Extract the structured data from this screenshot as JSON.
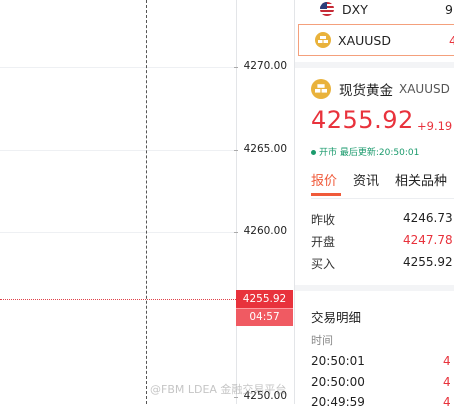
{
  "watchlist": [
    {
      "symbol": "DXY",
      "value": "9",
      "flag": "us-flag-icon"
    },
    {
      "symbol": "XAUUSD",
      "value": "4",
      "flag": "gold-coin-icon"
    }
  ],
  "price_axis": {
    "ticks": [
      "4270.00",
      "4265.00",
      "4260.00",
      "4250.00"
    ],
    "current_price": "4255.92",
    "countdown": "04:57"
  },
  "detail": {
    "name_cn": "现货黄金",
    "code": "XAUUSD",
    "price": "4255.92",
    "change": "+9.19",
    "status": "开市 最后更新:20:50:01"
  },
  "tabs": [
    {
      "label": "报价",
      "active": true
    },
    {
      "label": "资讯",
      "active": false
    },
    {
      "label": "相关品种",
      "active": false
    }
  ],
  "quote": {
    "prev_close_label": "昨收",
    "prev_close": "4246.73",
    "open_label": "开盘",
    "open": "4247.78",
    "bid_label": "买入",
    "bid": "4255.92"
  },
  "trades": {
    "title": "交易明细",
    "time_header": "时间",
    "rows": [
      {
        "time": "20:50:01",
        "price": "4"
      },
      {
        "time": "20:50:00",
        "price": "4"
      },
      {
        "time": "20:49:59",
        "price": "4"
      }
    ]
  },
  "watermark": "@FBM LDEA 金融交易平台",
  "colors": {
    "up": "#e8323c",
    "accent": "#f05a3a",
    "open_status": "#1a9a6c",
    "gold": "#e9b23b"
  }
}
